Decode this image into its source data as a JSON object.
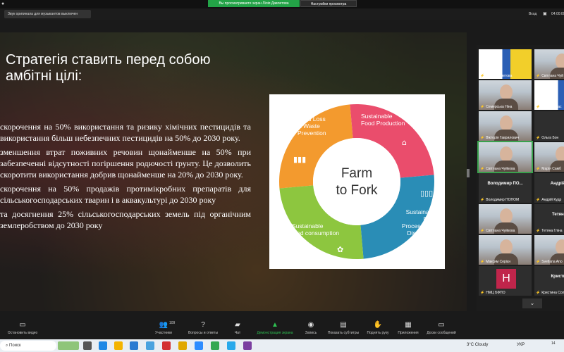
{
  "topbar": {
    "viewing_badge": "Вы просматриваете экран Лілія Давлетова",
    "view_options": "Настройки просмотра"
  },
  "subbar": {
    "sound_notice": "Звук оригинала для музыкантов выключен",
    "enter_label": "Вход",
    "timer": "04:00:00"
  },
  "slide": {
    "title": "Стратегія ставить перед собою амбітні цілі:",
    "bullets": [
      "скорочення на 50% використання та ризику хімічних пестицидів та використання більш небезпечних пестицидів на 50% до 2030 року.",
      "зменшення втрат поживних речовин щонайменше на 50% при забезпеченні відсутності погіршення родючості ґрунту. Це дозволить скоротити використання добрив щонайменше на 20% до 2030 року.",
      "скорочення на 50% продажів протимікробних препаратів для сільськогосподарських тварин і в аквакультурі до 2030 року",
      "та досягнення 25% сільськогосподарських земель під органічним землеробством до 2030 року"
    ],
    "diagram": {
      "center_line1": "Farm",
      "center_line2": "to Fork",
      "segments": [
        {
          "label_lines": [
            "Food Loss",
            "& Waste",
            "Prevention"
          ],
          "color": "#f39a2e"
        },
        {
          "label_lines": [
            "Sustainable",
            "Food Production"
          ],
          "color": "#ea4d6c"
        },
        {
          "label_lines": [
            "Sustainable",
            "Food",
            "Processing &",
            "Distribution"
          ],
          "color": "#2a8db6"
        },
        {
          "label_lines": [
            "Sustainable",
            "food consumption"
          ],
          "color": "#8dc63f"
        }
      ]
    }
  },
  "gallery": {
    "tiles": [
      {
        "label": "Лілія Давлетова"
      },
      {
        "label": "Світлана Чуй"
      },
      {
        "label": "Семерська Ніна"
      },
      {
        "label": "Вікторія Вас"
      },
      {
        "label": "Вікторія Гаврилович"
      },
      {
        "label": "Ольга Бон"
      },
      {
        "label": "Світлана Чуйкова"
      },
      {
        "label": "Марія Самб"
      },
      {
        "title": "Володимир ПО...",
        "label": "Володимир ПОНОМ"
      },
      {
        "title": "Андрій Ку",
        "label": "Андрій Кудр"
      },
      {
        "label": "Світлана Чуйкова"
      },
      {
        "title": "Тетяна Г",
        "label": "Тетяна Гліна"
      },
      {
        "label": "Максим Серієн"
      },
      {
        "label": "Svetlana Ano"
      },
      {
        "avatar": "Н",
        "label": "НМЦ БФПО"
      },
      {
        "title": "Кристина",
        "label": "Кристина Сол"
      }
    ]
  },
  "toolbar": {
    "video": "Остановить видео",
    "participants": "Участники",
    "participants_count": "109",
    "qa": "Вопросы и ответы",
    "chat": "Чат",
    "share": "Демонстрация экрана",
    "record": "Запись",
    "captions": "Показать субтитры",
    "raise_hand": "Поднять руку",
    "apps": "Приложения",
    "whiteboard": "Доски сообщений"
  },
  "taskbar": {
    "search": "Поиск",
    "weather": "3°C  Cloudy",
    "lang": "УКР",
    "time": "14"
  }
}
